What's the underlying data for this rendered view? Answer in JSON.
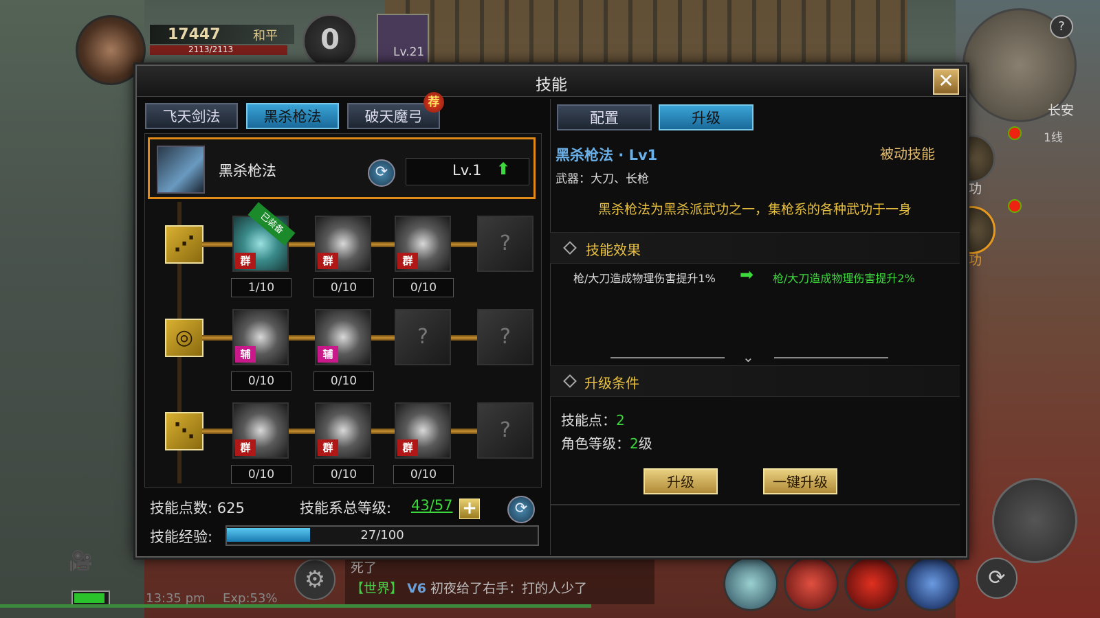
{
  "hud": {
    "power": "17447",
    "mode": "和平",
    "hp": "2113/2113",
    "pk_value": "0",
    "pet_level": "Lv.21",
    "map_city": "长安",
    "map_line": "1线",
    "help": "?",
    "qigong_label": "气功",
    "wugong_label": "武功",
    "time": "13:35 pm",
    "exp": "Exp:53%",
    "chat_line1": "死了",
    "chat_channel": "【世界】",
    "chat_vip": "V6",
    "chat_text": "初夜给了右手：打的人少了"
  },
  "dialog": {
    "title": "技能",
    "close": "✕"
  },
  "left_tabs": [
    {
      "label": "飞天剑法",
      "active": false
    },
    {
      "label": "黑杀枪法",
      "active": true
    },
    {
      "label": "破天魔弓",
      "active": false
    }
  ],
  "recommend_badge": "荐",
  "selected": {
    "name": "黑杀枪法",
    "level": "Lv.1",
    "up_arrow": "⬆"
  },
  "tree": {
    "row_icons": [
      "spear-fan-icon",
      "swirl-icon",
      "slash-icon"
    ],
    "equipped_tag": "已装备",
    "rows": [
      {
        "nodes": [
          {
            "type": "active",
            "tag": "群",
            "count": "1/10"
          },
          {
            "type": "grey",
            "tag": "群",
            "count": "0/10"
          },
          {
            "type": "grey",
            "tag": "群",
            "count": "0/10"
          },
          {
            "type": "locked",
            "tag": "",
            "count": ""
          }
        ]
      },
      {
        "nodes": [
          {
            "type": "grey",
            "tag": "辅",
            "count": "0/10"
          },
          {
            "type": "grey",
            "tag": "辅",
            "count": "0/10"
          },
          {
            "type": "locked",
            "tag": "",
            "count": ""
          },
          {
            "type": "locked",
            "tag": "",
            "count": ""
          }
        ]
      },
      {
        "nodes": [
          {
            "type": "grey",
            "tag": "群",
            "count": "0/10"
          },
          {
            "type": "grey",
            "tag": "群",
            "count": "0/10"
          },
          {
            "type": "grey",
            "tag": "群",
            "count": "0/10"
          },
          {
            "type": "locked",
            "tag": "",
            "count": ""
          }
        ]
      }
    ]
  },
  "footer": {
    "points_label": "技能点数:",
    "points_value": "625",
    "total_label": "技能系总等级:",
    "total_value": "43/57",
    "plus": "+",
    "exp_label": "技能经验:",
    "exp_text": "27/100",
    "exp_fraction": 0.27
  },
  "right_tabs": [
    {
      "label": "配置",
      "active": false
    },
    {
      "label": "升级",
      "active": true
    }
  ],
  "detail": {
    "title": "黑杀枪法 · Lv1",
    "type": "被动技能",
    "weapon": "武器：大刀、长枪",
    "desc": "黑杀枪法为黑杀派武功之一，集枪系的各种武功于一身",
    "effect_header": "技能效果",
    "effect_old": "枪/大刀造成物理伤害提升1%",
    "effect_new": "枪/大刀造成物理伤害提升2%",
    "cond_header": "升级条件",
    "cond_points_label": "技能点：",
    "cond_points_value": "2",
    "cond_level_label": "角色等级：",
    "cond_level_value": "2",
    "cond_level_unit": "级",
    "btn_upgrade": "升级",
    "btn_upgrade_all": "一键升级"
  },
  "colors": {
    "accent_orange": "#e08a18",
    "tab_active": "#3aa4d6",
    "green": "#3cd83c",
    "gold": "#e8c040"
  }
}
